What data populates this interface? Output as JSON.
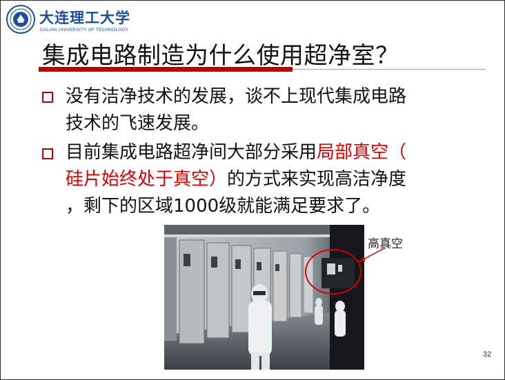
{
  "header": {
    "university_name": "大连理工大学",
    "university_name_en": "DALIAN UNIVERSITY OF TECHNOLOGY"
  },
  "slide": {
    "title": "集成电路制造为什么使用超净室？",
    "bullets": [
      {
        "line1": "没有洁净技术的发展，谈不上现代集成电路",
        "line2": "技术的飞速发展。"
      },
      {
        "line1_prefix": "目前集成电路超净间大部分采用",
        "line1_highlight": "局部真空（",
        "line2_highlight": "硅片始终处于真空）",
        "line2_suffix": "的方式来实现高洁净度",
        "line3": "，剩下的区域1000级就能满足要求了。"
      }
    ],
    "image_callout_label": "高真空",
    "page_number": "32"
  },
  "colors": {
    "accent_red": "#c00000",
    "highlight_red": "#e00000",
    "brand_blue": "#1b4f9c"
  },
  "icons": [
    "university-seal-icon",
    "checkbox-bullet-icon"
  ]
}
